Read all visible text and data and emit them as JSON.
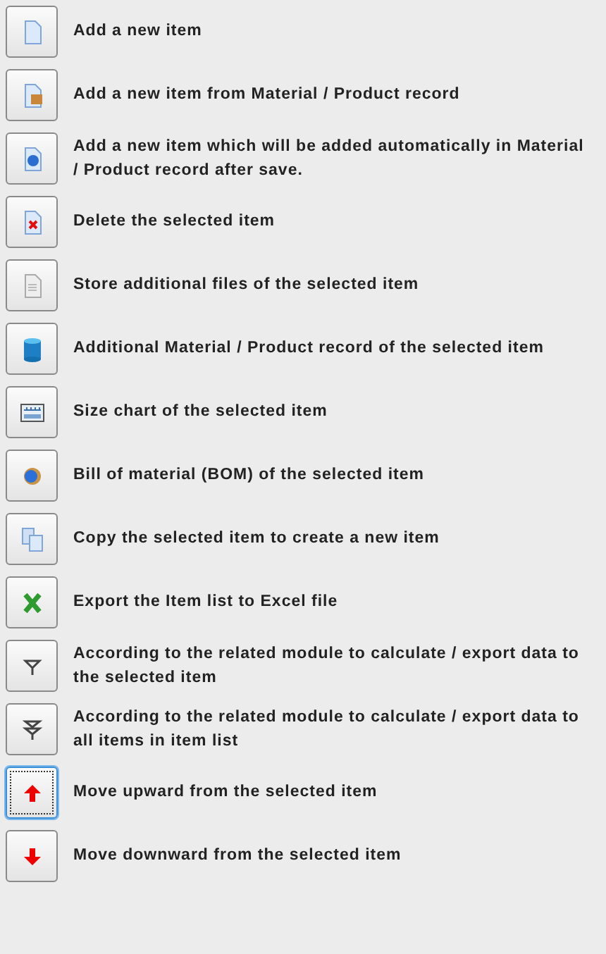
{
  "items": [
    {
      "kind": "page",
      "text": "Add a new item",
      "focused": false
    },
    {
      "kind": "box",
      "text": "Add a new item from Material / Product record",
      "focused": false
    },
    {
      "kind": "orb",
      "text": "Add a new item which will be added automatically in Material / Product record after save.",
      "focused": false
    },
    {
      "kind": "delete",
      "text": "Delete the selected item",
      "focused": false
    },
    {
      "kind": "files",
      "text": "Store additional files of the selected item",
      "focused": false
    },
    {
      "kind": "database",
      "text": "Additional Material / Product record of the selected item",
      "focused": false
    },
    {
      "kind": "ruler",
      "text": "Size chart of the selected item",
      "focused": false
    },
    {
      "kind": "globe",
      "text": "Bill of material (BOM) of the selected item",
      "focused": false
    },
    {
      "kind": "copy",
      "text": "Copy the selected item to create a new item",
      "focused": false
    },
    {
      "kind": "excel",
      "text": "Export the Item list to Excel file",
      "focused": false
    },
    {
      "kind": "funnel",
      "text": "According to the related module to calculate / export data to the selected item",
      "focused": false
    },
    {
      "kind": "double",
      "text": "According to the related module to calculate / export data to all items in item list",
      "focused": false
    },
    {
      "kind": "up",
      "text": "Move upward from the selected item",
      "focused": true
    },
    {
      "kind": "down",
      "text": "Move downward from the selected item",
      "focused": false
    }
  ]
}
